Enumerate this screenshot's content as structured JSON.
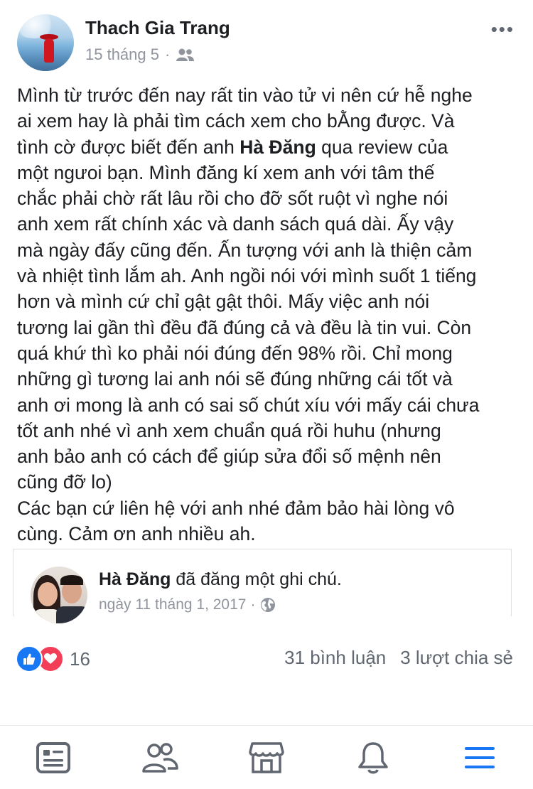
{
  "post": {
    "author": "Thach Gia Trang",
    "date": "15 tháng 5",
    "separator": "·",
    "audience_icon": "friends-icon",
    "more_icon": "more-options-icon",
    "text_before": "Mình từ trước đến nay rất tin vào tử vi nên cứ hễ nghe\nai xem hay là phải tìm cách xem cho bẰng được. Và\ntình cờ được biết đến anh ",
    "text_bold": "Hà Đăng",
    "text_after": " qua review của\nmột ngưoi bạn. Mình đăng kí xem anh với tâm thế\nchắc phải chờ rất lâu rồi cho đỡ sốt ruột vì nghe nói\nanh xem rất chính xác và danh sách quá dài. Ấy vậy\nmà ngày đấy cũng đến. Ấn tượng với anh là thiện cảm\nvà nhiệt tình lắm ah. Anh ngồi nói với mình suốt 1 tiếng\nhơn và mình cứ chỉ gật gật thôi. Mấy việc anh nói\ntương lai gần thì đều đã đúng cả và đều là tin vui. Còn\nquá khứ thì ko phải nói đúng đến 98% rồi. Chỉ mong\nnhững gì tương lai anh nói sẽ đúng những cái tốt và\nanh ơi mong là anh có sai số chút xíu với mấy cái chưa\ntốt anh nhé vì anh xem chuẩn quá rồi huhu (nhưng\nanh bảo anh có cách để giúp sửa đổi số mệnh nên\ncũng đỡ lo)\nCác bạn cứ liên hệ với anh nhé đảm bảo hài lòng vô\ncùng. Cảm ơn anh nhiều ah."
  },
  "shared": {
    "author": "Hà Đăng",
    "action": " đã đăng một ghi chú.",
    "date": "ngày 11 tháng 1, 2017",
    "separator": "·",
    "privacy_icon": "globe-icon"
  },
  "engagement": {
    "reaction_count": "16",
    "comments": "31 bình luận",
    "shares": "3 lượt chia sẻ",
    "like_color": "#1877f2",
    "love_color": "#f33e58"
  },
  "nav": {
    "items": [
      "news-feed-icon",
      "friends-icon",
      "marketplace-icon",
      "notifications-icon",
      "menu-icon"
    ],
    "active_color": "#1877f2",
    "inactive_color": "#606770"
  }
}
